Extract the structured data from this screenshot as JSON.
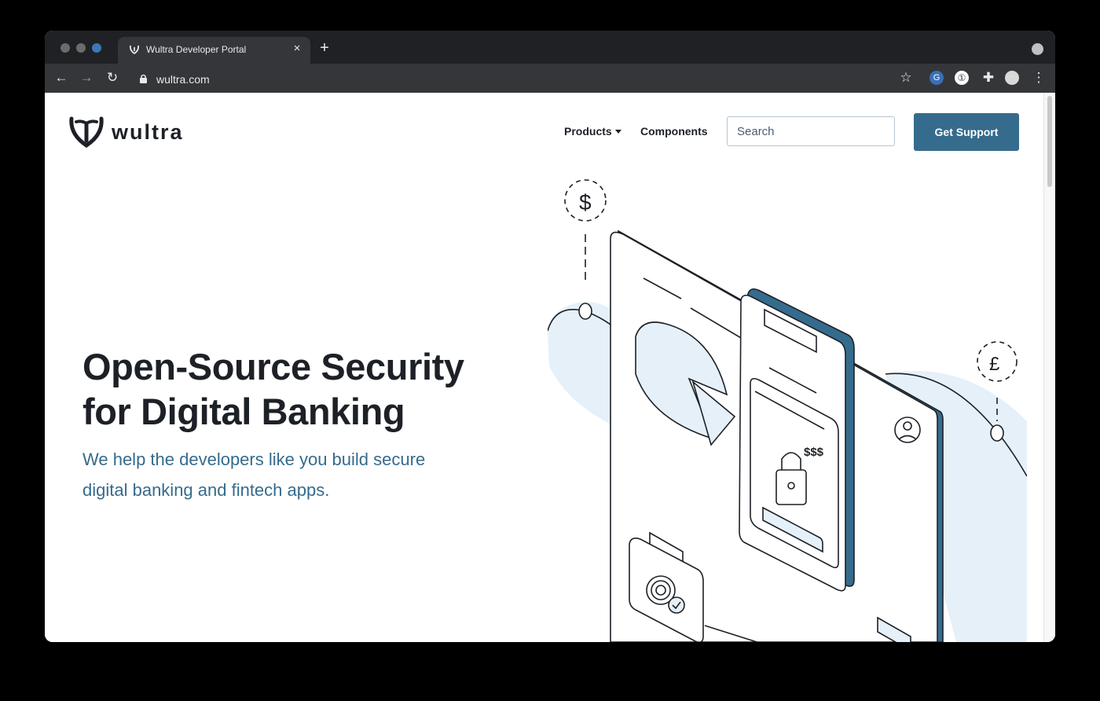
{
  "browser": {
    "tab_title": "Wultra Developer Portal",
    "tab_close": "×",
    "new_tab": "+",
    "url": "wultra.com",
    "back": "←",
    "forward": "→",
    "reload": "↻",
    "star": "☆",
    "menu": "⋮",
    "extensions": [
      "G",
      "①",
      "✚"
    ]
  },
  "nav": {
    "brand": "wultra",
    "products": "Products",
    "components": "Components",
    "search_placeholder": "Search",
    "support": "Get Support"
  },
  "hero": {
    "title_line1": "Open-Source Security",
    "title_line2": "for Digital Banking",
    "subtitle_line1": "We help the developers like you build secure",
    "subtitle_line2": "digital banking and fintech apps."
  },
  "illustration": {
    "dollar": "$",
    "pound": "£",
    "money_label": "$$$"
  },
  "colors": {
    "accent": "#356b8c",
    "text": "#1d2127",
    "light_blue": "#e6f0f9"
  }
}
